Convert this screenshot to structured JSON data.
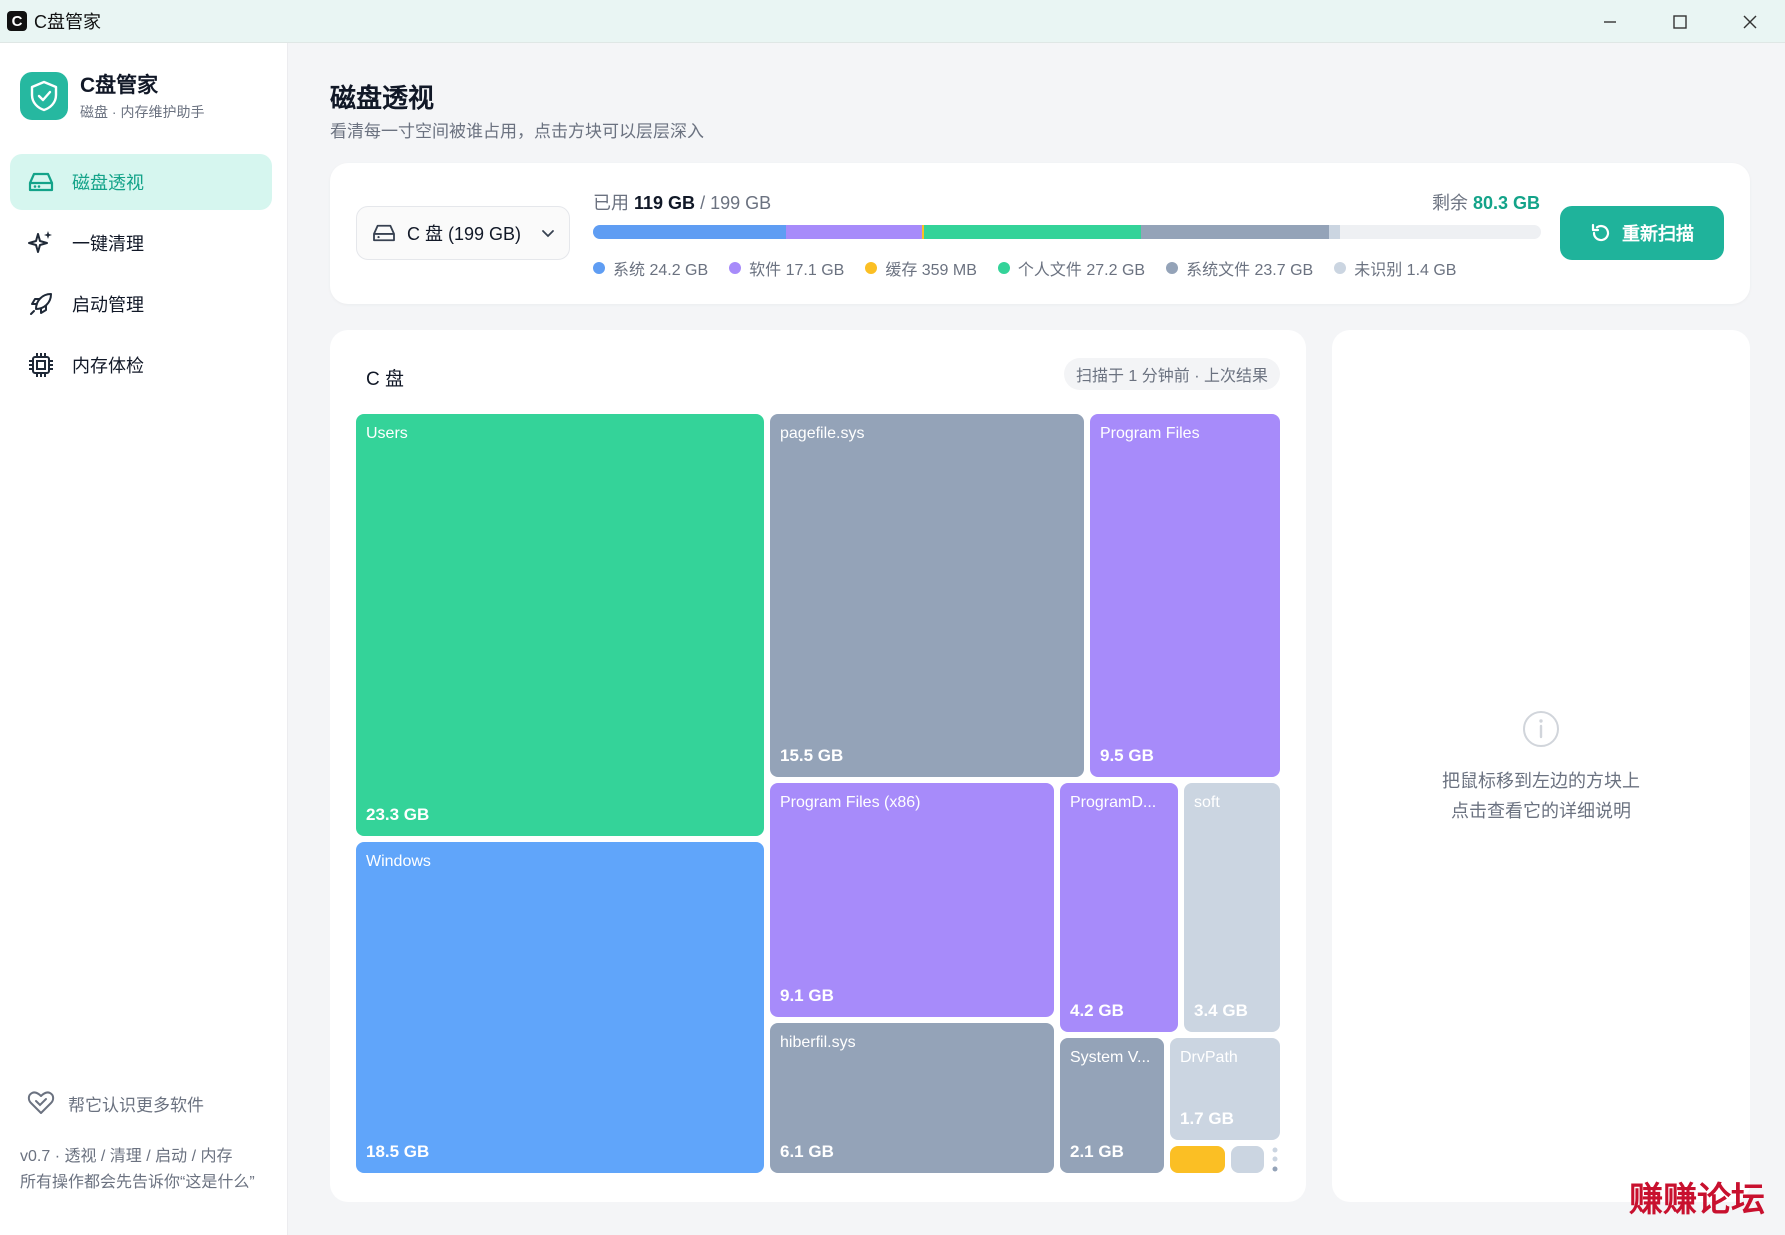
{
  "window": {
    "title": "C盘管家"
  },
  "brand": {
    "name": "C盘管家",
    "subtitle": "磁盘 · 内存维护助手"
  },
  "nav": [
    {
      "label": "磁盘透视",
      "icon": "drive-icon",
      "active": true
    },
    {
      "label": "一键清理",
      "icon": "sparkles-icon",
      "active": false
    },
    {
      "label": "启动管理",
      "icon": "rocket-icon",
      "active": false
    },
    {
      "label": "内存体检",
      "icon": "chip-icon",
      "active": false
    }
  ],
  "help_label": "帮它认识更多软件",
  "footer": {
    "line1": "v0.7 · 透视 / 清理 / 启动 / 内存",
    "line2": "所有操作都会先告诉你“这是什么”"
  },
  "page": {
    "title": "磁盘透视",
    "subtitle": "看清每一寸空间被谁占用，点击方块可以层层深入"
  },
  "disk": {
    "selector_label": "C 盘 (199 GB)",
    "used_prefix": "已用",
    "used": "119 GB",
    "total": "/ 199 GB",
    "free_prefix": "剩余",
    "free": "80.3 GB",
    "rescan_label": "重新扫描",
    "segments": [
      {
        "label": "系统 24.2 GB",
        "gb": 24.2,
        "color": "#5f9df3"
      },
      {
        "label": "软件 17.1 GB",
        "gb": 17.1,
        "color": "#a78bfa"
      },
      {
        "label": "缓存 359 MB",
        "gb": 0.359,
        "color": "#fbbf24"
      },
      {
        "label": "个人文件 27.2 GB",
        "gb": 27.2,
        "color": "#34d399"
      },
      {
        "label": "系统文件 23.7 GB",
        "gb": 23.7,
        "color": "#94a3b8"
      },
      {
        "label": "未识别 1.4 GB",
        "gb": 1.4,
        "color": "#cbd5e1"
      }
    ],
    "capacity_gb": 199
  },
  "treemap": {
    "title": "C 盘",
    "badge": "扫描于 1 分钟前 · 上次结果",
    "tiles": [
      {
        "name": "Users",
        "size": "23.3 GB",
        "color": "#34d399"
      },
      {
        "name": "Windows",
        "size": "18.5 GB",
        "color": "#60a5fa"
      },
      {
        "name": "pagefile.sys",
        "size": "15.5 GB",
        "color": "#94a3b8"
      },
      {
        "name": "Program Files",
        "size": "9.5 GB",
        "color": "#a78bfa"
      },
      {
        "name": "Program Files (x86)",
        "size": "9.1 GB",
        "color": "#a78bfa"
      },
      {
        "name": "ProgramD...",
        "size": "4.2 GB",
        "color": "#a78bfa"
      },
      {
        "name": "soft",
        "size": "3.4 GB",
        "color": "#cbd5e1"
      },
      {
        "name": "hiberfil.sys",
        "size": "6.1 GB",
        "color": "#94a3b8"
      },
      {
        "name": "System V...",
        "size": "2.1 GB",
        "color": "#94a3b8"
      },
      {
        "name": "DrvPath",
        "size": "1.7 GB",
        "color": "#cbd5e1"
      }
    ]
  },
  "detail": {
    "line1": "把鼠标移到左边的方块上",
    "line2": "点击查看它的详细说明"
  },
  "watermark": "赚赚论坛"
}
